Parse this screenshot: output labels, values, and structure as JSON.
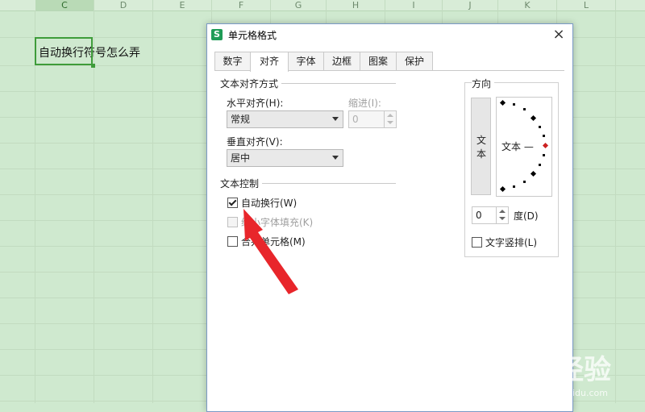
{
  "spreadsheet": {
    "columns": [
      "C",
      "D",
      "E",
      "F",
      "G",
      "H",
      "I",
      "J",
      "K",
      "L"
    ],
    "active_column": "C",
    "cell_text": "自动换行符号怎么弄"
  },
  "dialog": {
    "title": "单元格格式",
    "app_icon": "S",
    "close_glyph": "×",
    "tabs": [
      "数字",
      "对齐",
      "字体",
      "边框",
      "图案",
      "保护"
    ],
    "active_tab": "对齐",
    "text_align": {
      "title": "文本对齐方式",
      "horizontal_label": "水平对齐(H):",
      "horizontal_value": "常规",
      "indent_label": "缩进(I):",
      "indent_value": "0",
      "vertical_label": "垂直对齐(V):",
      "vertical_value": "居中"
    },
    "text_control": {
      "title": "文本控制",
      "wrap_label": "自动换行(W)",
      "wrap_checked": true,
      "shrink_label": "缩小字体填充(K)",
      "shrink_checked": false,
      "merge_label": "合并单元格(M)",
      "merge_checked": false
    },
    "orientation": {
      "title": "方向",
      "vertical_text_1": "文",
      "vertical_text_2": "本",
      "dial_text": "文本 —",
      "degree_value": "0",
      "degree_label": "度(D)",
      "stack_label": "文字竖排(L)",
      "stack_checked": false
    }
  },
  "watermark": {
    "text": "Bai 经验",
    "sub": "jingyan.baidu.com"
  },
  "colors": {
    "sheet_bg": "#cfe9cf",
    "selection": "#3e9c3a",
    "pointer_arrow": "#e8262b"
  }
}
